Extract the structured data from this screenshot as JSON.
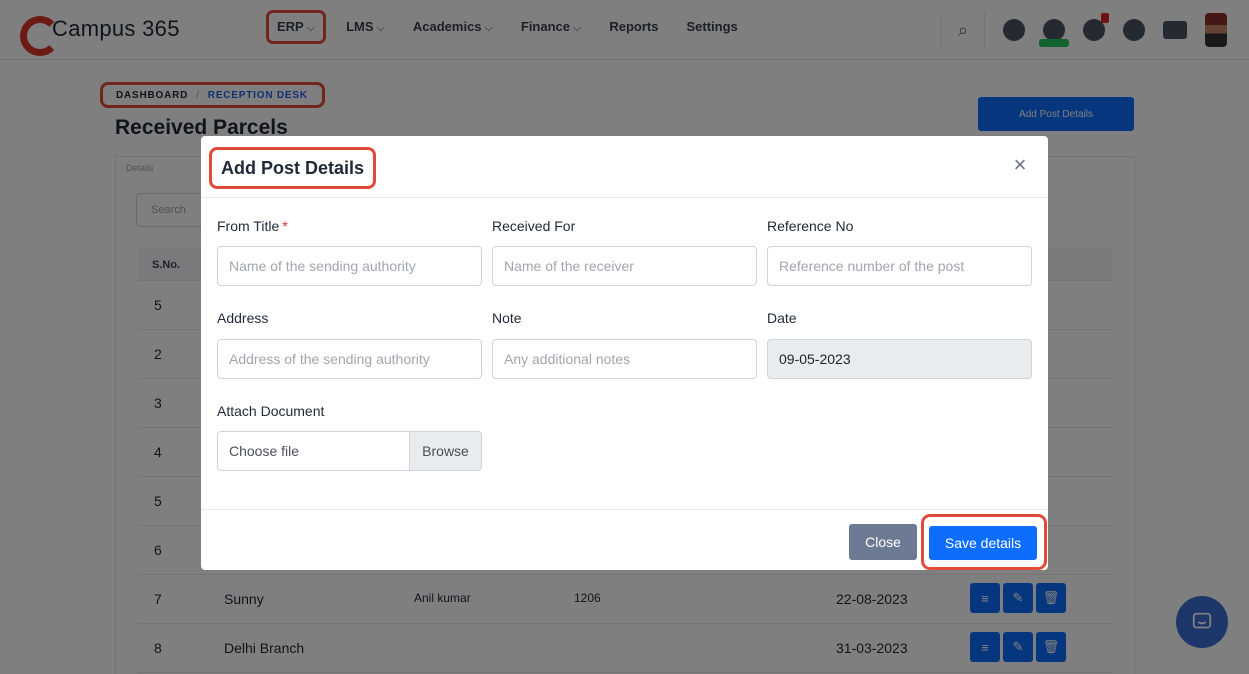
{
  "app": {
    "name": "Campus 365"
  },
  "nav": {
    "items": [
      {
        "label": "ERP",
        "active": true
      },
      {
        "label": "LMS"
      },
      {
        "label": "Academics"
      },
      {
        "label": "Finance"
      },
      {
        "label": "Reports"
      },
      {
        "label": "Settings"
      }
    ]
  },
  "breadcrumb": {
    "home": "DASHBOARD",
    "separator": "/",
    "current": "RECEPTION DESK"
  },
  "page": {
    "title": "Received Parcels",
    "add_button": "Add Post Details",
    "card_note": "Details",
    "search_placeholder": "Search"
  },
  "table": {
    "header": "S.No.",
    "rows": [
      {
        "sno": "5",
        "from": "",
        "for": "",
        "ref": "",
        "date": ""
      },
      {
        "sno": "2",
        "from": "",
        "for": "",
        "ref": "",
        "date": ""
      },
      {
        "sno": "3",
        "from": "",
        "for": "",
        "ref": "",
        "date": ""
      },
      {
        "sno": "4",
        "from": "",
        "for": "",
        "ref": "",
        "date": ""
      },
      {
        "sno": "5",
        "from": "",
        "for": "",
        "ref": "",
        "date": ""
      },
      {
        "sno": "6",
        "from": "",
        "for": "",
        "ref": "",
        "date": ""
      },
      {
        "sno": "7",
        "from": "Sunny",
        "for": "Anil kumar",
        "ref": "1206",
        "date": "22-08-2023"
      },
      {
        "sno": "8",
        "from": "Delhi Branch",
        "for": "",
        "ref": "",
        "date": "31-03-2023"
      }
    ]
  },
  "modal": {
    "title": "Add Post Details",
    "close_icon": "×",
    "fields": {
      "from_title": {
        "label": "From Title",
        "required_mark": "*",
        "placeholder": "Name of the sending authority",
        "value": ""
      },
      "received_for": {
        "label": "Received For",
        "placeholder": "Name of the receiver",
        "value": ""
      },
      "reference_no": {
        "label": "Reference No",
        "placeholder": "Reference number of the post",
        "value": ""
      },
      "address": {
        "label": "Address",
        "placeholder": "Address of the sending authority",
        "value": ""
      },
      "note": {
        "label": "Note",
        "placeholder": "Any additional notes",
        "value": ""
      },
      "date": {
        "label": "Date",
        "value": "09-05-2023"
      },
      "attach": {
        "label": "Attach Document",
        "file_text": "Choose file",
        "browse": "Browse"
      }
    },
    "buttons": {
      "close": "Close",
      "save": "Save details"
    }
  },
  "colors": {
    "accent": "#0d6efd",
    "highlight": "#e14b3b",
    "close_button": "#6c7a93"
  },
  "icons": {
    "search": "search-icon",
    "chat": "chat-icon",
    "close": "close-icon",
    "list": "list-icon",
    "edit": "edit-icon",
    "delete": "trash-icon"
  }
}
